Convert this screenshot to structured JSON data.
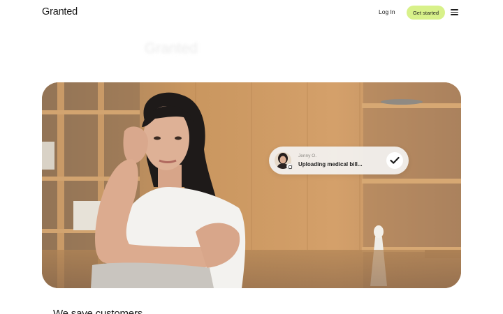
{
  "header": {
    "logo": "Granted",
    "login_label": "Log In",
    "cta_label": "Get started",
    "menu_icon": "hamburger-menu-icon"
  },
  "hero": {
    "ghost_heading": "Granted",
    "toast": {
      "name": "Jenny O.",
      "message": "Uploading medical bill...",
      "status_icon": "checkmark-icon"
    }
  },
  "section": {
    "heading": "We save customers"
  },
  "colors": {
    "cta_background": "#d8f18a",
    "text": "#1c1c1c",
    "toast_background": "#f2f1ef"
  }
}
